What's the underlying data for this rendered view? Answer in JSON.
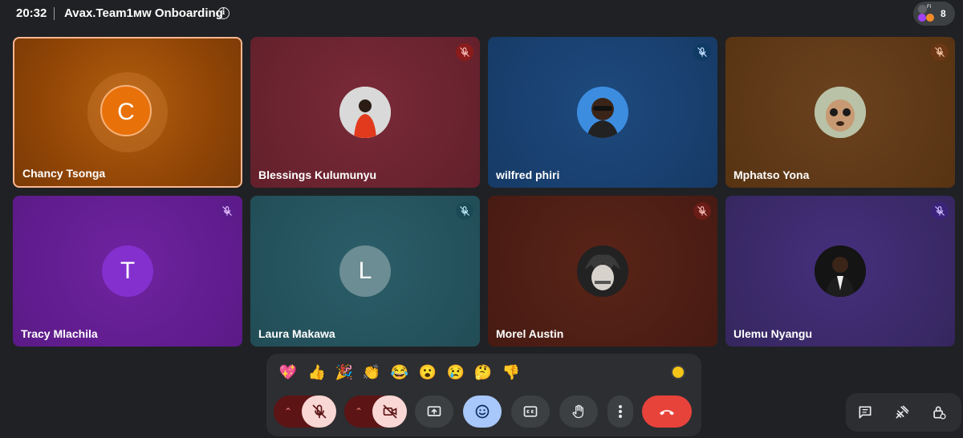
{
  "meeting": {
    "time": "20:32",
    "title": "Avax.Team1мw Onboarding",
    "participant_count": "8"
  },
  "tiles": [
    {
      "name": "Chancy Tsonga",
      "avatar_letter": "C",
      "bg": "#9a4a06",
      "avatar_color": "#e8710a",
      "active": true,
      "muted": false
    },
    {
      "name": "Blessings Kulumunyu",
      "bg": "#6d2330",
      "muted": true,
      "mute_color": "#8a1c1c"
    },
    {
      "name": "wilfred phiri",
      "bg": "#163a66",
      "muted": true,
      "mute_color": "#0f3a63"
    },
    {
      "name": "Mphatso Yona",
      "bg": "#5b3513",
      "muted": true,
      "mute_color": "#6b3715"
    },
    {
      "name": "Tracy Mlachila",
      "avatar_letter": "T",
      "bg": "#5e1a8a",
      "avatar_color": "#8430ce",
      "muted": true,
      "mute_color": "#5c1d8c"
    },
    {
      "name": "Laura Makawa",
      "avatar_letter": "L",
      "bg": "#23505a",
      "avatar_color": "#6b8d93",
      "muted": true,
      "mute_color": "#1b4a56"
    },
    {
      "name": "Morel Austin",
      "bg": "#4d1c14",
      "muted": true,
      "mute_color": "#6b1c16"
    },
    {
      "name": "Ulemu Nyangu",
      "bg": "#3a2a6e",
      "muted": true,
      "mute_color": "#3b237a"
    }
  ],
  "reactions": [
    "💖",
    "👍",
    "🎉",
    "👏",
    "😂",
    "😮",
    "😢",
    "🤔",
    "👎"
  ],
  "controls": {
    "mic_icon": "mic-off-icon",
    "camera_icon": "camera-off-icon",
    "present_icon": "present-screen-icon",
    "reactions_icon": "emoji-icon",
    "captions_icon": "captions-icon",
    "raise_hand_icon": "hand-icon",
    "more_icon": "more-vert-icon",
    "leave_icon": "call-end-icon"
  },
  "side_controls": [
    "chat-icon",
    "activities-icon",
    "host-controls-icon"
  ]
}
